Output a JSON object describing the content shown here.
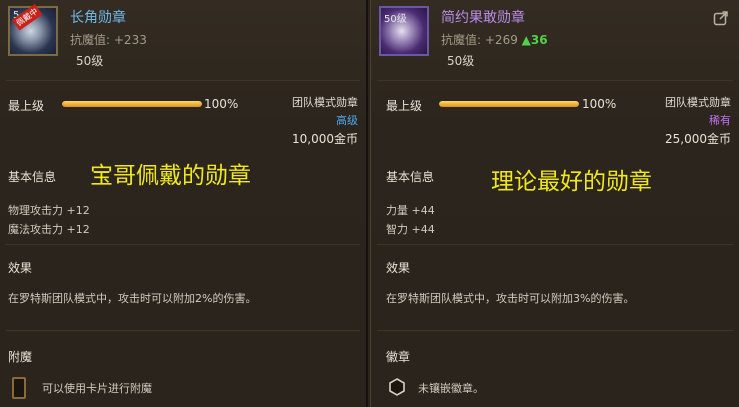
{
  "left": {
    "icon_level": "5",
    "icon_badge": "佩戴中",
    "name": "长角勋章",
    "stat_label": "抗魔值",
    "stat_value": ": +233",
    "level": "50级",
    "max_level_label": "最上级",
    "progress": 100,
    "progress_text": "100%",
    "mode": "团队模式勋章",
    "rarity": "高级",
    "rarity_color": "#4fa8f0",
    "price": "10,000金币",
    "basic_info": "基本信息",
    "caption": "宝哥佩戴的勋章",
    "stats": [
      "物理攻击力 +12",
      "魔法攻击力 +12"
    ],
    "effect_title": "效果",
    "effect_text": "在罗特斯团队模式中，攻击时可以附加2%的伤害。",
    "bottom_title": "附魔",
    "bottom_text": "可以使用卡片进行附魔"
  },
  "right": {
    "icon_level": "50级",
    "name": "简约果敢勋章",
    "stat_label": "抗魔值",
    "stat_value": ": +269",
    "stat_up": "▲36",
    "level": "50级",
    "max_level_label": "最上级",
    "progress": 100,
    "progress_text": "100%",
    "mode": "团队模式勋章",
    "rarity": "稀有",
    "rarity_color": "#c070f0",
    "price": "25,000金币",
    "basic_info": "基本信息",
    "caption": "理论最好的勋章",
    "stats": [
      "力量 +44",
      "智力 +44"
    ],
    "effect_title": "效果",
    "effect_text": "在罗特斯团队模式中，攻击时可以附加3%的伤害。",
    "bottom_title": "徽章",
    "bottom_text": "未镶嵌徽章。"
  }
}
